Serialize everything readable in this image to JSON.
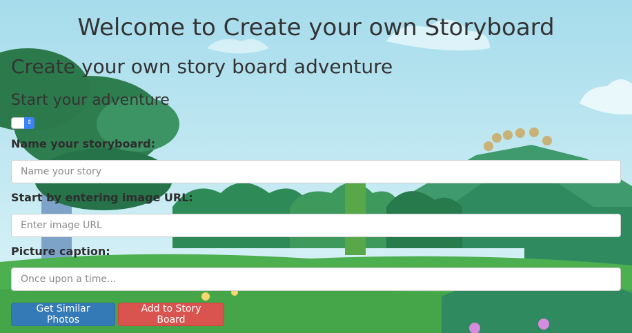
{
  "page": {
    "title": "Welcome to Create your own Storyboard",
    "subtitle": "Create your own story board adventure",
    "section_heading": "Start your adventure"
  },
  "story_select": {
    "selected_value": "",
    "accent_color": "#3b82f6"
  },
  "form": {
    "name_label": "Name your storyboard:",
    "name_placeholder": "Name your story",
    "name_value": "",
    "image_label": "Start by entering image URL:",
    "image_placeholder": "Enter image URL",
    "image_value": "",
    "caption_label": "Picture caption:",
    "caption_placeholder": "Once upon a time...",
    "caption_value": ""
  },
  "buttons": {
    "similar_label": "Get Similar Photos",
    "add_label": "Add to Story Board",
    "primary_color": "#337ab7",
    "danger_color": "#d9534f"
  },
  "background": {
    "sky_top": "#a9dfef",
    "sky_bottom": "#d8f4f8",
    "grass": "#4caf50",
    "hills": "#2e8b57"
  }
}
